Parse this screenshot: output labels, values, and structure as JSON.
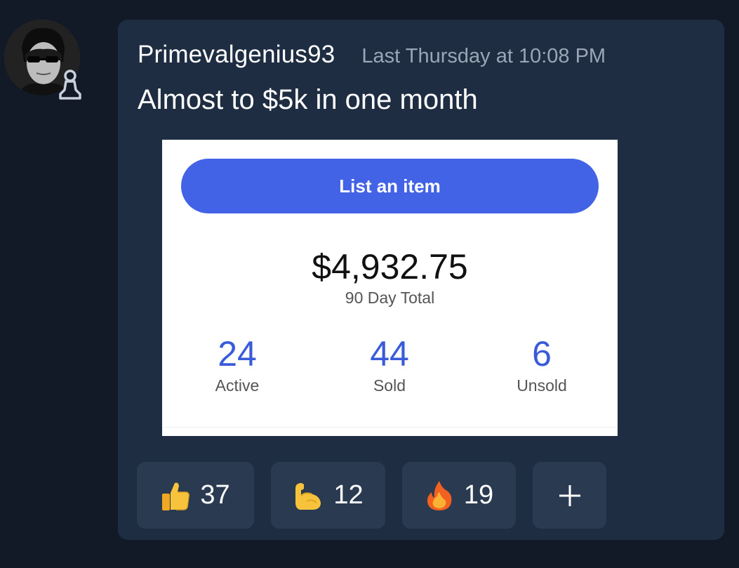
{
  "message": {
    "author": "Primevalgenius93",
    "timestamp": "Last Thursday at 10:08 PM",
    "text": "Almost to $5k in one month"
  },
  "attachment": {
    "list_button_label": "List an item",
    "total_amount": "$4,932.75",
    "total_label": "90 Day Total",
    "stats": [
      {
        "value": "24",
        "label": "Active"
      },
      {
        "value": "44",
        "label": "Sold"
      },
      {
        "value": "6",
        "label": "Unsold"
      }
    ],
    "accent_color": "#4263e6"
  },
  "reactions": [
    {
      "icon": "thumbs-up-icon",
      "count": "37"
    },
    {
      "icon": "flexed-biceps-icon",
      "count": "12"
    },
    {
      "icon": "fire-icon",
      "count": "19"
    }
  ],
  "add_reaction": {
    "icon": "plus-icon"
  }
}
